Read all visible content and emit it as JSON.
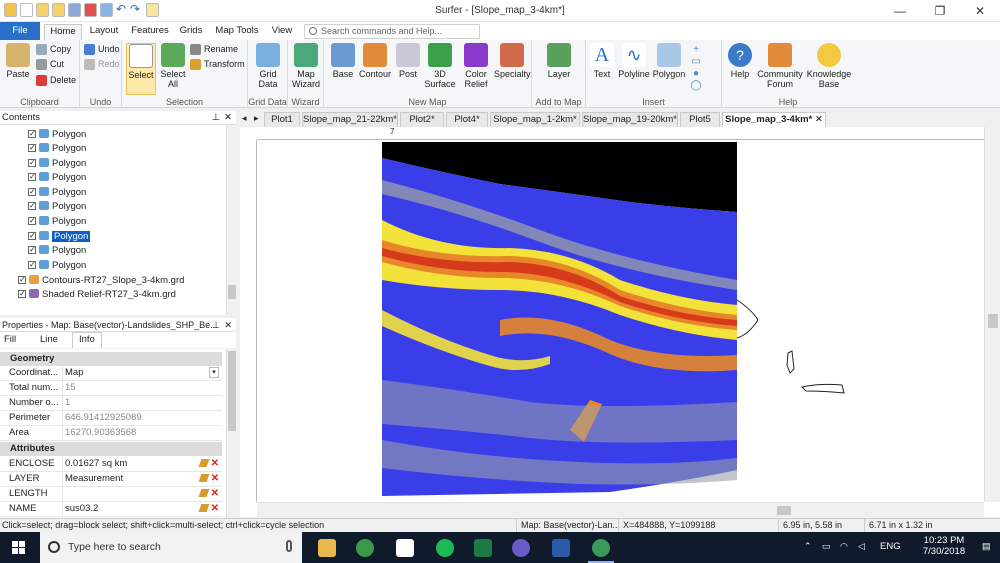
{
  "window": {
    "title": "Surfer - [Slope_map_3-4km*]"
  },
  "ribbon_tabs": [
    "File",
    "Home",
    "Layout",
    "Features",
    "Grids",
    "Map Tools",
    "View"
  ],
  "search": {
    "placeholder": "Search commands and Help..."
  },
  "ribbon": {
    "clipboard": {
      "paste": "Paste",
      "copy": "Copy",
      "cut": "Cut",
      "delete": "Delete",
      "label": "Clipboard"
    },
    "undo": {
      "undo": "Undo",
      "redo": "Redo",
      "label": "Undo"
    },
    "selection": {
      "select": "Select",
      "select_all": "Select All",
      "rename": "Rename",
      "transform": "Transform",
      "label": "Selection"
    },
    "grid_data": {
      "btn": "Grid Data",
      "label": "Grid Data"
    },
    "wizard": {
      "btn": "Map Wizard",
      "label": "Wizard"
    },
    "new_map": {
      "base": "Base",
      "contour": "Contour",
      "post": "Post",
      "surface": "3D Surface",
      "color_relief": "Color Relief",
      "specialty": "Specialty",
      "label": "New Map"
    },
    "add_to_map": {
      "layer": "Layer",
      "label": "Add to Map"
    },
    "insert": {
      "text": "Text",
      "polyline": "Polyline",
      "polygon": "Polygon",
      "label": "Insert"
    },
    "help": {
      "help": "Help",
      "community": "Community Forum",
      "kb": "Knowledge Base",
      "label": "Help"
    }
  },
  "contents": {
    "header": "Contents",
    "items": [
      "Polygon",
      "Polygon",
      "Polygon",
      "Polygon",
      "Polygon",
      "Polygon",
      "Polygon",
      "Polygon",
      "Polygon",
      "Polygon"
    ],
    "selected_index": 7,
    "layers": [
      "Contours-RT27_Slope_3-4km.grd",
      "Shaded Relief-RT27_3-4km.grd"
    ]
  },
  "properties": {
    "header": "Properties - Map: Base(vector)-Landslides_SHP_Be...",
    "tabs": [
      "Fill",
      "Line",
      "Info"
    ],
    "active_tab": "Info",
    "geometry": {
      "title": "Geometry",
      "rows": [
        {
          "k": "Coordinat...",
          "v": "Map"
        },
        {
          "k": "Total num...",
          "v": "15"
        },
        {
          "k": "Number o...",
          "v": "1"
        },
        {
          "k": "Perimeter",
          "v": "646.91412925089"
        },
        {
          "k": "Area",
          "v": "16270.90363568"
        }
      ]
    },
    "attributes": {
      "title": "Attributes",
      "rows": [
        {
          "k": "ENCLOSE",
          "v": "0.01627 sq km"
        },
        {
          "k": "LAYER",
          "v": "Measurement"
        },
        {
          "k": "LENGTH",
          "v": ""
        },
        {
          "k": "NAME",
          "v": "sus03.2"
        }
      ]
    }
  },
  "doc_tabs": [
    "Plot1",
    "Slope_map_21-22km*",
    "Plot2*",
    "Plot4*",
    "Slope_map_1-2km*",
    "Slope_map_19-20km*",
    "Plot5",
    "Slope_map_3-4km*"
  ],
  "ruler_mark": "7",
  "status": {
    "hint": "Click=select; drag=block select; shift+click=multi-select; ctrl+click=cycle selection",
    "object": "Map: Base(vector)-Lan...",
    "coords": "X=484888, Y=1099188",
    "pos": "6.95 in, 5.58 in",
    "size": "6.71 in x 1.32 in"
  },
  "taskbar": {
    "search_placeholder": "Type here to search",
    "lang": "ENG",
    "time": "10:23 PM",
    "date": "7/30/2018"
  }
}
